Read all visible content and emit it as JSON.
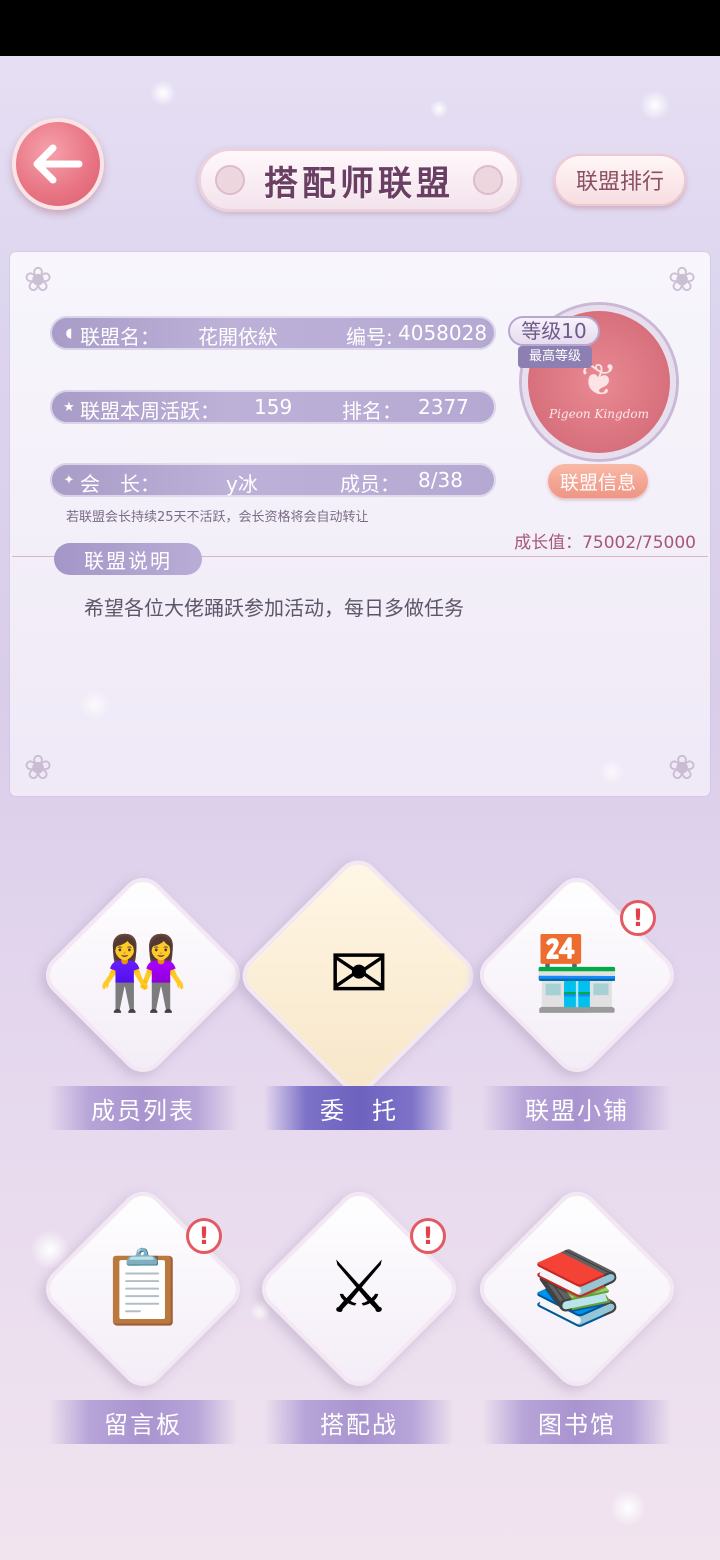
{
  "header": {
    "back_icon": "arrow-left-icon",
    "title": "搭配师联盟",
    "rank_button": "联盟排行"
  },
  "union": {
    "name_label": "联盟名：",
    "name_value": "花開依紎",
    "id_label": "编号:",
    "id_value": "4058028",
    "weekly_label": "联盟本周活跃：",
    "weekly_value": "159",
    "rank_label": "排名：",
    "rank_value": "2377",
    "leader_label": "会　长：",
    "leader_value": "y冰",
    "members_label": "成员：",
    "members_value": "8/38",
    "level_badge": "等级10",
    "max_level_tag": "最高等级",
    "emblem_text": "Pigeon Kingdom",
    "info_button": "联盟信息",
    "notice": "若联盟会长持续25天不活跃，会长资格将会自动转让",
    "growth": "成长值：75002/75000"
  },
  "description": {
    "tag": "联盟说明",
    "text": "希望各位大佬踊跃参加活动，每日多做任务"
  },
  "features": [
    {
      "label": "成员列表",
      "icon": "members-icon",
      "alert": false
    },
    {
      "label": "委　托",
      "icon": "letter-quill-icon",
      "alert": false
    },
    {
      "label": "联盟小铺",
      "icon": "shop-icon",
      "alert": true
    },
    {
      "label": "留言板",
      "icon": "message-board-icon",
      "alert": true
    },
    {
      "label": "搭配战",
      "icon": "crossed-swords-icon",
      "alert": true
    },
    {
      "label": "图书馆",
      "icon": "library-icon",
      "alert": false
    }
  ],
  "alert_symbol": "!"
}
